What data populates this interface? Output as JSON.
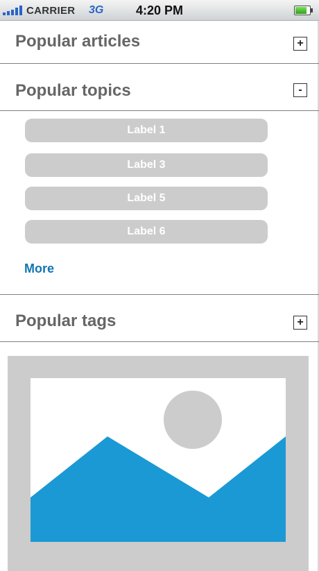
{
  "status_bar": {
    "carrier": "CARRIER",
    "network": "3G",
    "time": "4:20 PM",
    "signal_icon": "signal-bars-icon",
    "battery_icon": "battery-icon"
  },
  "sections": {
    "articles": {
      "title": "Popular articles",
      "toggle": "+"
    },
    "topics": {
      "title": "Popular topics",
      "toggle": "-"
    },
    "tags": {
      "title": "Popular tags",
      "toggle": "+"
    }
  },
  "topics_list": {
    "labels": [
      "Label 1",
      "Label 3",
      "Label 5",
      "Label 6"
    ],
    "more": "More"
  },
  "image": {
    "icon": "image-placeholder-icon"
  },
  "colors": {
    "title_gray": "#666666",
    "button_gray": "#cccccc",
    "link_blue": "#1175b2",
    "mountain_blue": "#1b99d4",
    "placeholder_gray": "#cccccc"
  }
}
